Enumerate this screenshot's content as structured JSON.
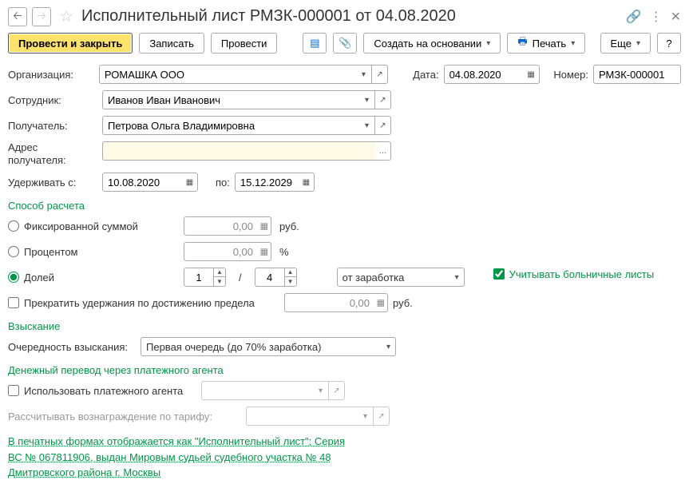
{
  "header": {
    "title": "Исполнительный лист РМЗК-000001 от 04.08.2020"
  },
  "toolbar": {
    "post_close": "Провести и закрыть",
    "save": "Записать",
    "post": "Провести",
    "create_based": "Создать на основании",
    "print": "Печать",
    "more": "Еще",
    "help": "?"
  },
  "form": {
    "org_label": "Организация:",
    "org_value": "РОМАШКА ООО",
    "date_label": "Дата:",
    "date_value": "04.08.2020",
    "number_label": "Номер:",
    "number_value": "РМЗК-000001",
    "employee_label": "Сотрудник:",
    "employee_value": "Иванов Иван Иванович",
    "recipient_label": "Получатель:",
    "recipient_value": "Петрова Ольга Владимировна",
    "address_label": "Адрес получателя:",
    "address_value": "",
    "withhold_from_label": "Удерживать с:",
    "withhold_from_value": "10.08.2020",
    "withhold_to_label": "по:",
    "withhold_to_value": "15.12.2029"
  },
  "method": {
    "header": "Способ расчета",
    "fixed_label": "Фиксированной суммой",
    "fixed_value": "0,00",
    "fixed_unit": "руб.",
    "percent_label": "Процентом",
    "percent_value": "0,00",
    "percent_unit": "%",
    "share_label": "Долей",
    "share_num": "1",
    "share_den": "4",
    "share_of_value": "от заработка",
    "sick_leave_label": "Учитывать больничные листы",
    "stop_label": "Прекратить удержания по достижению предела",
    "stop_value": "0,00",
    "stop_unit": "руб."
  },
  "collection": {
    "header": "Взыскание",
    "priority_label": "Очередность взыскания:",
    "priority_value": "Первая очередь (до 70% заработка)"
  },
  "agent": {
    "header": "Денежный перевод через платежного агента",
    "use_label": "Использовать платежного агента",
    "tariff_label": "Рассчитывать вознаграждение по тарифу:"
  },
  "footer": {
    "link_text": "В печатных формах отображается как \"Исполнительный лист\"; Серия ВС № 067811906, выдан Мировым судьей судебного участка № 48 Дмитровского района г. Москвы"
  }
}
